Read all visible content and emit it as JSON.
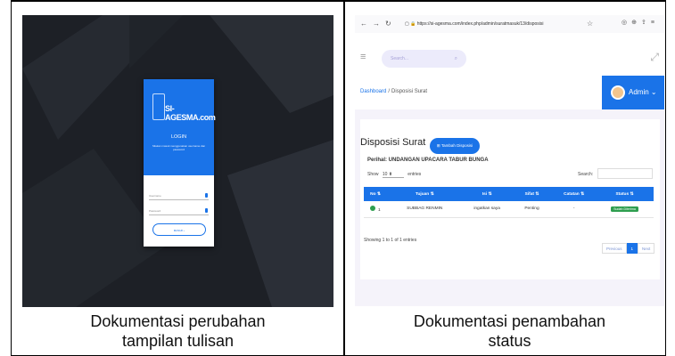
{
  "captions": {
    "left": [
      "Dokumentasi perubahan",
      "tampilan tulisan"
    ],
    "right": [
      "Dokumentasi penambahan",
      "status"
    ]
  },
  "login": {
    "brand": "SI-AGESMA.com",
    "title": "LOGIN",
    "subtitle": "Silakan masuk menggunakan username dan password",
    "username_placeholder": "Username",
    "password_placeholder": "Password",
    "button_label": "MASUK",
    "colors": {
      "accent": "#1a73e8",
      "background": "#1d2026"
    }
  },
  "browser": {
    "url": "https://si-agesma.com/index.php/admin/suratmasuk/13/disposisi",
    "search_placeholder": "Search...",
    "breadcrumb": {
      "root": "Dashboard",
      "separator": "/",
      "current": "Disposisi Surat"
    },
    "user_label": "Admin",
    "page_title": "Disposisi Surat",
    "add_button": "Tambah Disposisi",
    "perihal": "Perihal: UNDANGAN UPACARA TABUR BUNGA",
    "show_label": "Show",
    "show_value": "10",
    "entries_label": "entries",
    "search_label": "Search:",
    "table": {
      "headers": [
        "No",
        "Tujuan",
        "Isi",
        "Sifat",
        "Catatan",
        "Status"
      ],
      "rows": [
        {
          "no": "1",
          "tujuan": "SUBBAG RENMIN",
          "isi": "ingatkan saya",
          "sifat": "Penting",
          "catatan": "-",
          "status": "Sudah Diterima"
        }
      ]
    },
    "info": "Showing 1 to 1 of 1 entries",
    "pager": {
      "previous": "Previous",
      "page": "1",
      "next": "Next"
    },
    "colors": {
      "accent": "#1a73e8",
      "status_green": "#2e9e4f"
    }
  }
}
